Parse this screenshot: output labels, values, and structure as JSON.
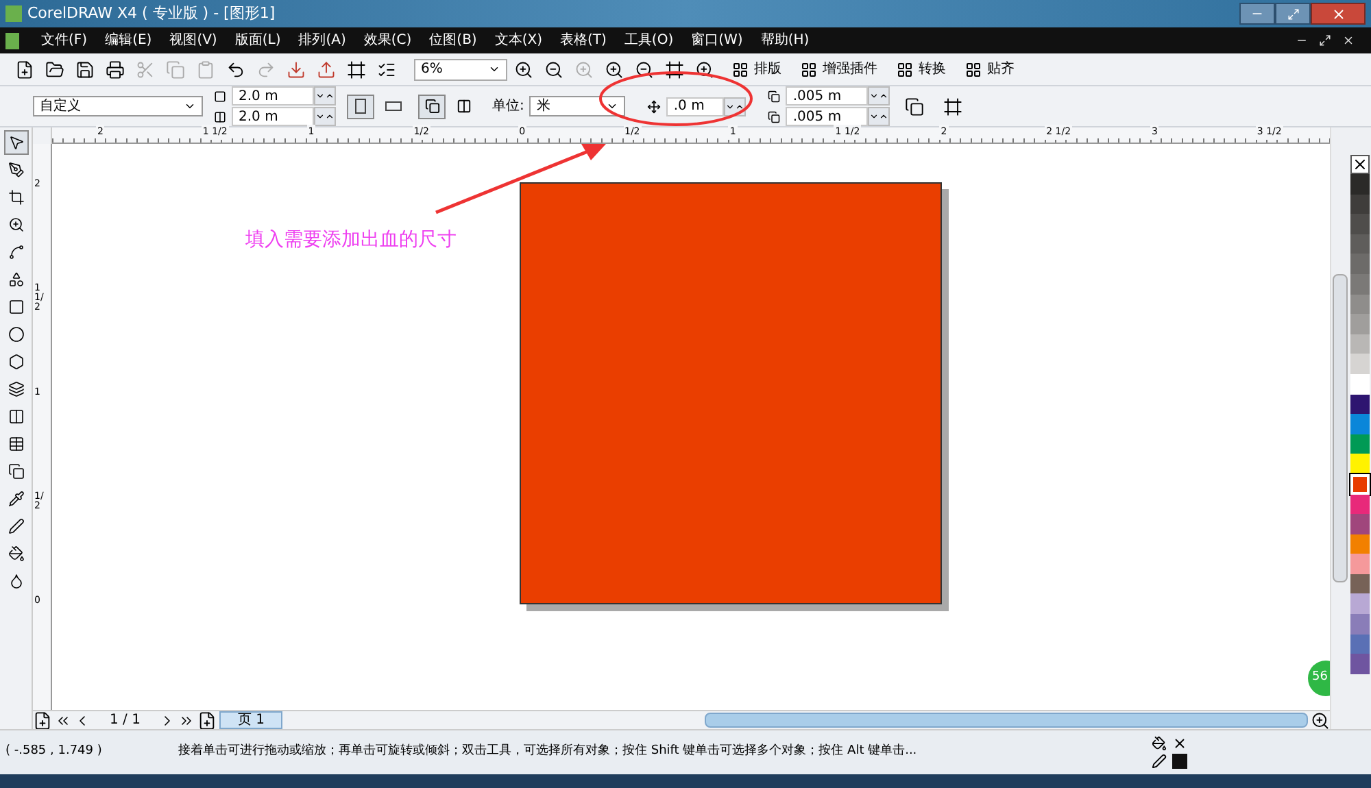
{
  "window": {
    "title": "CorelDRAW X4 ( 专业版 ) - [图形1]"
  },
  "menu": [
    "文件(F)",
    "编辑(E)",
    "视图(V)",
    "版面(L)",
    "排列(A)",
    "效果(C)",
    "位图(B)",
    "文本(X)",
    "表格(T)",
    "工具(O)",
    "窗口(W)",
    "帮助(H)"
  ],
  "toolbar": {
    "zoom": "6%",
    "buttons": [
      "排版",
      "增强插件",
      "转换",
      "贴齐"
    ]
  },
  "property_bar": {
    "preset": "自定义",
    "width": "2.0 m",
    "height": "2.0 m",
    "orientation": [
      {
        "kind": "portrait",
        "selected": true
      },
      {
        "kind": "landscape",
        "selected": false
      }
    ],
    "units_label": "单位:",
    "units": "米",
    "bleed": ".0 m",
    "nudge_x": ".005 m",
    "nudge_y": ".005 m"
  },
  "ruler_h": [
    "2",
    "1 1/2",
    "1",
    "1/2",
    "0",
    "1/2",
    "1",
    "1 1/2",
    "2",
    "2 1/2",
    "3",
    "3 1/2"
  ],
  "ruler_v": [
    "2",
    "1 1/2",
    "1",
    "1/2",
    "0"
  ],
  "annotation": {
    "text": "填入需要添加出血的尺寸"
  },
  "palette": [
    {
      "color": "#2b2a28",
      "selected": false
    },
    {
      "color": "#3f3d3b",
      "selected": false
    },
    {
      "color": "#4f4d4b",
      "selected": false
    },
    {
      "color": "#5f5d5b",
      "selected": false
    },
    {
      "color": "#6d6b69",
      "selected": false
    },
    {
      "color": "#7b7977",
      "selected": false
    },
    {
      "color": "#8f8d8b",
      "selected": false
    },
    {
      "color": "#a09e9c",
      "selected": false
    },
    {
      "color": "#b9b7b5",
      "selected": false
    },
    {
      "color": "#d6d4d2",
      "selected": false
    },
    {
      "color": "#ffffff",
      "selected": false
    },
    {
      "color": "#2e1570",
      "selected": false
    },
    {
      "color": "#0a86d9",
      "selected": false
    },
    {
      "color": "#009a55",
      "selected": false
    },
    {
      "color": "#fff200",
      "selected": false
    },
    {
      "color": "#e83c00",
      "selected": true
    },
    {
      "color": "#e8297a",
      "selected": false
    },
    {
      "color": "#a0467c",
      "selected": false
    },
    {
      "color": "#f28000",
      "selected": false
    },
    {
      "color": "#f5999b",
      "selected": false
    },
    {
      "color": "#776257",
      "selected": false
    },
    {
      "color": "#b8a8d4",
      "selected": false
    },
    {
      "color": "#8a7db8",
      "selected": false
    },
    {
      "color": "#5a70b5",
      "selected": false
    },
    {
      "color": "#6f55a0",
      "selected": false
    }
  ],
  "page_nav": {
    "count": "1 / 1",
    "tab": "页 1"
  },
  "badge": "56",
  "status_bar": {
    "coords": "( -.585 , 1.749 )",
    "message": "接着单击可进行拖动或缩放；再单击可旋转或倾斜；双击工具，可选择所有对象；按住 Shift 键单击可选择多个对象；按住 Alt 键单击..."
  }
}
